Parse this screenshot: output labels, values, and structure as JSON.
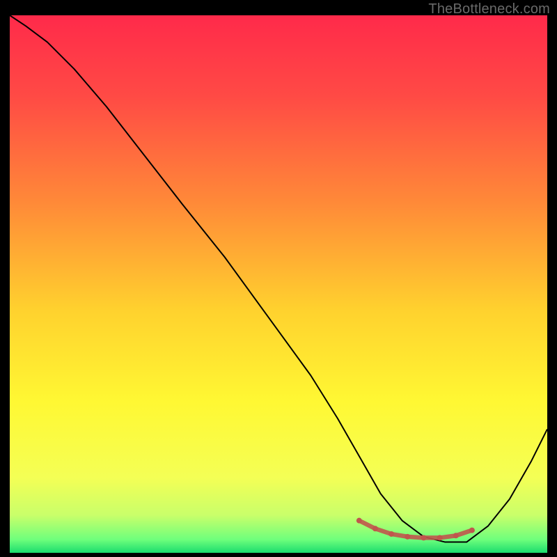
{
  "watermark": "TheBottleneck.com",
  "chart_data": {
    "type": "line",
    "title": "",
    "xlabel": "",
    "ylabel": "",
    "xlim": [
      0,
      100
    ],
    "ylim": [
      0,
      100
    ],
    "grid": false,
    "legend": false,
    "background_gradient_stops": [
      {
        "offset": 0.0,
        "color": "#ff2a4a"
      },
      {
        "offset": 0.15,
        "color": "#ff4a45"
      },
      {
        "offset": 0.35,
        "color": "#ff8a38"
      },
      {
        "offset": 0.55,
        "color": "#ffd22e"
      },
      {
        "offset": 0.72,
        "color": "#fff833"
      },
      {
        "offset": 0.86,
        "color": "#f4ff55"
      },
      {
        "offset": 0.93,
        "color": "#c9ff6a"
      },
      {
        "offset": 0.975,
        "color": "#6fff7c"
      },
      {
        "offset": 1.0,
        "color": "#1bdc6e"
      }
    ],
    "series": [
      {
        "name": "bottleneck-curve",
        "stroke": "#000000",
        "stroke_width": 2,
        "x": [
          0,
          3,
          7,
          12,
          18,
          25,
          32,
          40,
          48,
          56,
          61,
          65,
          69,
          73,
          77,
          81,
          85,
          89,
          93,
          97,
          100
        ],
        "values": [
          100,
          98,
          95,
          90,
          83,
          74,
          65,
          55,
          44,
          33,
          25,
          18,
          11,
          6,
          3,
          2,
          2,
          5,
          10,
          17,
          23
        ]
      }
    ],
    "highlight_band": {
      "name": "optimal-range",
      "color": "#c0564d",
      "marker_radius": 4,
      "x": [
        65,
        68,
        71,
        74,
        77,
        80,
        83,
        86
      ],
      "values": [
        6.0,
        4.5,
        3.5,
        3.0,
        2.8,
        2.8,
        3.2,
        4.2
      ]
    }
  }
}
